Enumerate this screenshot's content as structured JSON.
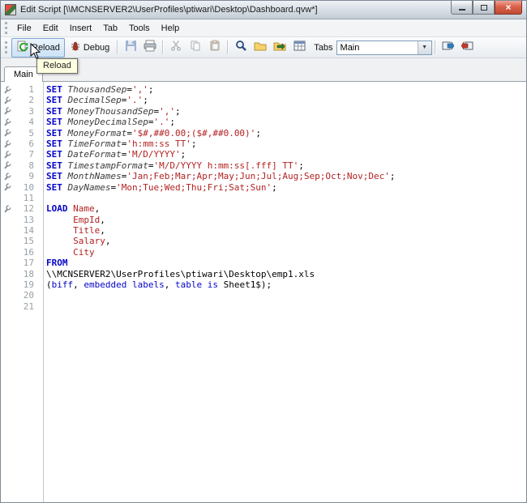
{
  "window": {
    "title": "Edit Script [\\\\MCNSERVER2\\UserProfiles\\ptiwari\\Desktop\\Dashboard.qvw*]"
  },
  "menu": {
    "items": [
      "File",
      "Edit",
      "Insert",
      "Tab",
      "Tools",
      "Help"
    ]
  },
  "toolbar": {
    "reload": "Reload",
    "debug": "Debug",
    "tabs_label": "Tabs",
    "tab_value": "Main"
  },
  "tooltip": {
    "text": "Reload"
  },
  "tabs": {
    "active": "Main"
  },
  "icons": {
    "dropdown_arrow": "▼",
    "close_glyph": "×"
  },
  "editor": {
    "lines": [
      {
        "num": 1,
        "marker": true,
        "tokens": [
          {
            "t": "kw",
            "v": "SET"
          },
          {
            "t": "pl",
            "v": " "
          },
          {
            "t": "var",
            "v": "ThousandSep"
          },
          {
            "t": "pl",
            "v": "="
          },
          {
            "t": "str",
            "v": "','"
          },
          {
            "t": "pl",
            "v": ";"
          }
        ]
      },
      {
        "num": 2,
        "marker": true,
        "tokens": [
          {
            "t": "kw",
            "v": "SET"
          },
          {
            "t": "pl",
            "v": " "
          },
          {
            "t": "var",
            "v": "DecimalSep"
          },
          {
            "t": "pl",
            "v": "="
          },
          {
            "t": "str",
            "v": "'.'"
          },
          {
            "t": "pl",
            "v": ";"
          }
        ]
      },
      {
        "num": 3,
        "marker": true,
        "tokens": [
          {
            "t": "kw",
            "v": "SET"
          },
          {
            "t": "pl",
            "v": " "
          },
          {
            "t": "var",
            "v": "MoneyThousandSep"
          },
          {
            "t": "pl",
            "v": "="
          },
          {
            "t": "str",
            "v": "','"
          },
          {
            "t": "pl",
            "v": ";"
          }
        ]
      },
      {
        "num": 4,
        "marker": true,
        "tokens": [
          {
            "t": "kw",
            "v": "SET"
          },
          {
            "t": "pl",
            "v": " "
          },
          {
            "t": "var",
            "v": "MoneyDecimalSep"
          },
          {
            "t": "pl",
            "v": "="
          },
          {
            "t": "str",
            "v": "'.'"
          },
          {
            "t": "pl",
            "v": ";"
          }
        ]
      },
      {
        "num": 5,
        "marker": true,
        "tokens": [
          {
            "t": "kw",
            "v": "SET"
          },
          {
            "t": "pl",
            "v": " "
          },
          {
            "t": "var",
            "v": "MoneyFormat"
          },
          {
            "t": "pl",
            "v": "="
          },
          {
            "t": "str",
            "v": "'$#,##0.00;($#,##0.00)'"
          },
          {
            "t": "pl",
            "v": ";"
          }
        ]
      },
      {
        "num": 6,
        "marker": true,
        "tokens": [
          {
            "t": "kw",
            "v": "SET"
          },
          {
            "t": "pl",
            "v": " "
          },
          {
            "t": "var",
            "v": "TimeFormat"
          },
          {
            "t": "pl",
            "v": "="
          },
          {
            "t": "str",
            "v": "'h:mm:ss TT'"
          },
          {
            "t": "pl",
            "v": ";"
          }
        ]
      },
      {
        "num": 7,
        "marker": true,
        "tokens": [
          {
            "t": "kw",
            "v": "SET"
          },
          {
            "t": "pl",
            "v": " "
          },
          {
            "t": "var",
            "v": "DateFormat"
          },
          {
            "t": "pl",
            "v": "="
          },
          {
            "t": "str",
            "v": "'M/D/YYYY'"
          },
          {
            "t": "pl",
            "v": ";"
          }
        ]
      },
      {
        "num": 8,
        "marker": true,
        "tokens": [
          {
            "t": "kw",
            "v": "SET"
          },
          {
            "t": "pl",
            "v": " "
          },
          {
            "t": "var",
            "v": "TimestampFormat"
          },
          {
            "t": "pl",
            "v": "="
          },
          {
            "t": "str",
            "v": "'M/D/YYYY h:mm:ss[.fff] TT'"
          },
          {
            "t": "pl",
            "v": ";"
          }
        ]
      },
      {
        "num": 9,
        "marker": true,
        "tokens": [
          {
            "t": "kw",
            "v": "SET"
          },
          {
            "t": "pl",
            "v": " "
          },
          {
            "t": "var",
            "v": "MonthNames"
          },
          {
            "t": "pl",
            "v": "="
          },
          {
            "t": "str",
            "v": "'Jan;Feb;Mar;Apr;May;Jun;Jul;Aug;Sep;Oct;Nov;Dec'"
          },
          {
            "t": "pl",
            "v": ";"
          }
        ]
      },
      {
        "num": 10,
        "marker": true,
        "tokens": [
          {
            "t": "kw",
            "v": "SET"
          },
          {
            "t": "pl",
            "v": " "
          },
          {
            "t": "var",
            "v": "DayNames"
          },
          {
            "t": "pl",
            "v": "="
          },
          {
            "t": "str",
            "v": "'Mon;Tue;Wed;Thu;Fri;Sat;Sun'"
          },
          {
            "t": "pl",
            "v": ";"
          }
        ]
      },
      {
        "num": 11,
        "marker": false,
        "tokens": []
      },
      {
        "num": 12,
        "marker": true,
        "tokens": [
          {
            "t": "kw",
            "v": "LOAD"
          },
          {
            "t": "pl",
            "v": " "
          },
          {
            "t": "fld",
            "v": "Name"
          },
          {
            "t": "pl",
            "v": ","
          }
        ]
      },
      {
        "num": 13,
        "marker": false,
        "tokens": [
          {
            "t": "pl",
            "v": "     "
          },
          {
            "t": "fld",
            "v": "EmpId"
          },
          {
            "t": "pl",
            "v": ","
          }
        ]
      },
      {
        "num": 14,
        "marker": false,
        "tokens": [
          {
            "t": "pl",
            "v": "     "
          },
          {
            "t": "fld",
            "v": "Title"
          },
          {
            "t": "pl",
            "v": ","
          }
        ]
      },
      {
        "num": 15,
        "marker": false,
        "tokens": [
          {
            "t": "pl",
            "v": "     "
          },
          {
            "t": "fld",
            "v": "Salary"
          },
          {
            "t": "pl",
            "v": ","
          }
        ]
      },
      {
        "num": 16,
        "marker": false,
        "tokens": [
          {
            "t": "pl",
            "v": "     "
          },
          {
            "t": "fld",
            "v": "City"
          }
        ]
      },
      {
        "num": 17,
        "marker": false,
        "tokens": [
          {
            "t": "kw",
            "v": "FROM"
          }
        ]
      },
      {
        "num": 18,
        "marker": false,
        "tokens": [
          {
            "t": "pl",
            "v": "\\\\MCNSERVER2\\UserProfiles\\ptiwari\\Desktop\\emp1.xls"
          }
        ]
      },
      {
        "num": 19,
        "marker": false,
        "tokens": [
          {
            "t": "pl",
            "v": "("
          },
          {
            "t": "spec",
            "v": "biff"
          },
          {
            "t": "pl",
            "v": ", "
          },
          {
            "t": "spec",
            "v": "embedded labels"
          },
          {
            "t": "pl",
            "v": ", "
          },
          {
            "t": "spec",
            "v": "table is"
          },
          {
            "t": "pl",
            "v": " Sheet1$);"
          }
        ]
      },
      {
        "num": 20,
        "marker": false,
        "tokens": []
      },
      {
        "num": 21,
        "marker": false,
        "tokens": []
      }
    ]
  }
}
